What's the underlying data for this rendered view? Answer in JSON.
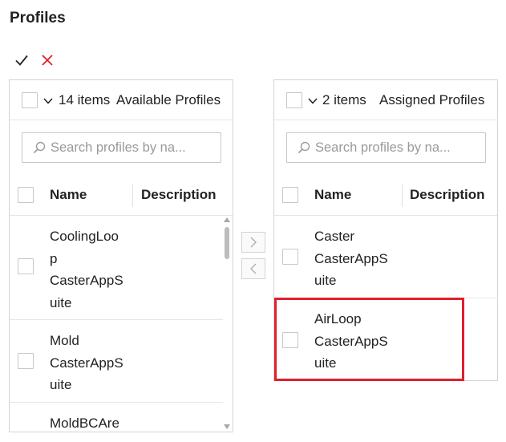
{
  "page": {
    "title": "Profiles"
  },
  "actions": {
    "confirm_icon": "checkmark-icon",
    "cancel_icon": "close-icon",
    "cancel_color": "#e0202b"
  },
  "available": {
    "count": "14 items",
    "title": "Available Profiles",
    "search_placeholder": "Search profiles by na...",
    "columns": {
      "name": "Name",
      "description": "Description"
    },
    "rows": [
      {
        "lines": [
          "CoolingLoo",
          "p",
          "CasterAppS",
          "uite"
        ]
      },
      {
        "lines": [
          "Mold",
          "CasterAppS",
          "uite"
        ]
      },
      {
        "lines": [
          "MoldBCAre"
        ]
      }
    ]
  },
  "transfer": {
    "move_right": ">",
    "move_left": "<"
  },
  "assigned": {
    "count": "2 items",
    "title": "Assigned Profiles",
    "search_placeholder": "Search profiles by na...",
    "columns": {
      "name": "Name",
      "description": "Description"
    },
    "rows": [
      {
        "lines": [
          "Caster",
          "CasterAppS",
          "uite"
        ]
      },
      {
        "lines": [
          "AirLoop",
          "CasterAppS",
          "uite"
        ]
      }
    ]
  },
  "highlight": {
    "color": "#e0202b"
  }
}
